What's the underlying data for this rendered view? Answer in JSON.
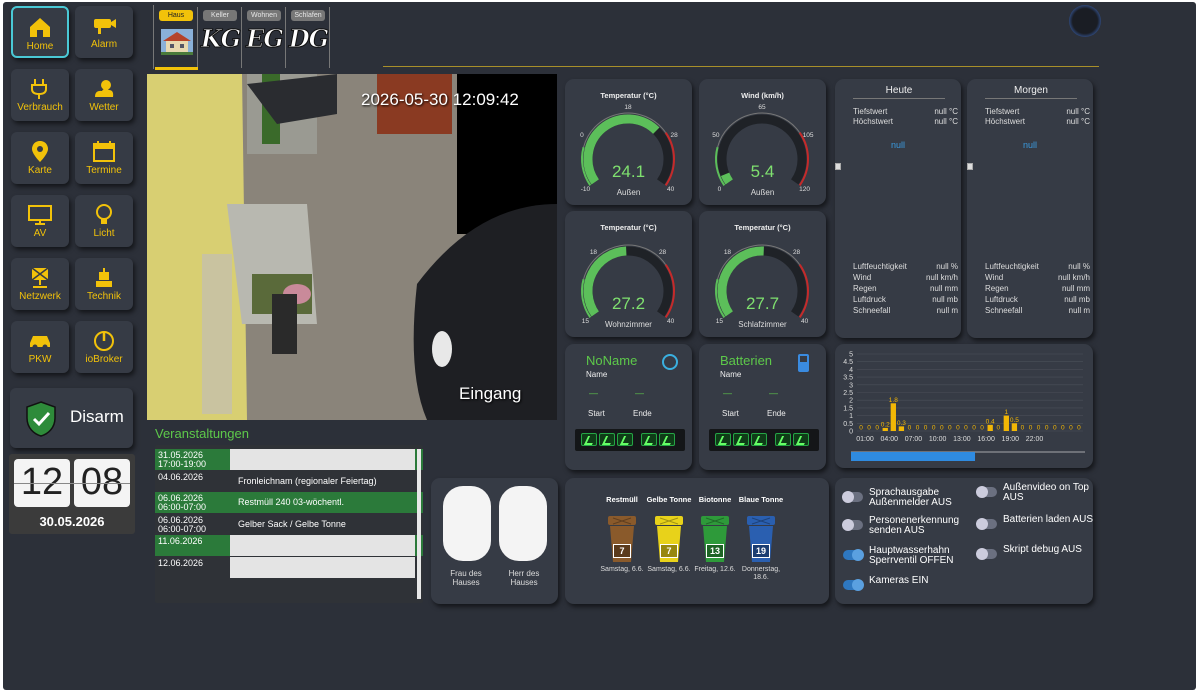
{
  "nav": [
    {
      "label": "Home",
      "icon": "home-icon"
    },
    {
      "label": "Alarm",
      "icon": "camera-icon"
    },
    {
      "label": "Verbrauch",
      "icon": "plug-icon"
    },
    {
      "label": "Wetter",
      "icon": "weather-icon"
    },
    {
      "label": "Karte",
      "icon": "map-pin-icon"
    },
    {
      "label": "Termine",
      "icon": "calendar-icon"
    },
    {
      "label": "AV",
      "icon": "tv-icon"
    },
    {
      "label": "Licht",
      "icon": "bulb-icon"
    },
    {
      "label": "Netzwerk",
      "icon": "network-icon"
    },
    {
      "label": "Technik",
      "icon": "robot-icon"
    },
    {
      "label": "PKW",
      "icon": "car-icon"
    },
    {
      "label": "ioBroker",
      "icon": "power-icon"
    }
  ],
  "disarm": {
    "label": "Disarm"
  },
  "clock": {
    "hours": "12",
    "minutes": "08",
    "date": "30.05.2026"
  },
  "tabs": [
    {
      "head": "Haus",
      "label": ""
    },
    {
      "head": "Keller",
      "label": "KG"
    },
    {
      "head": "Wohnen",
      "label": "EG"
    },
    {
      "head": "Schlafen",
      "label": "DG"
    }
  ],
  "camera": {
    "timestamp": "2026-05-30 12:09:42",
    "label": "Eingang"
  },
  "gauges": [
    {
      "title": "Temperatur (°C)",
      "value": "24.1",
      "sub": "Außen",
      "ticks": [
        "-10",
        "0",
        "18",
        "28",
        "40"
      ],
      "level": 0.68
    },
    {
      "title": "Wind (km/h)",
      "value": "5.4",
      "sub": "Außen",
      "ticks": [
        "0",
        "50",
        "65",
        "105",
        "120"
      ],
      "level": 0.05
    },
    {
      "title": "Temperatur (°C)",
      "value": "27.2",
      "sub": "Wohnzimmer",
      "ticks": [
        "15",
        "18",
        "28",
        "40"
      ],
      "level": 0.49
    },
    {
      "title": "Temperatur (°C)",
      "value": "27.7",
      "sub": "Schlafzimmer",
      "ticks": [
        "15",
        "18",
        "28",
        "40"
      ],
      "level": 0.51
    }
  ],
  "forecast": [
    {
      "day": "Heute",
      "tief_label": "Tiefstwert",
      "tief": "null °C",
      "hoch_label": "Höchstwert",
      "hoch": "null °C",
      "text": "null",
      "rows": [
        [
          "Luftfeuchtigkeit",
          "null %"
        ],
        [
          "Wind",
          "null km/h"
        ],
        [
          "Regen",
          "null mm"
        ],
        [
          "Luftdruck",
          "null mb"
        ],
        [
          "Schneefall",
          "null m"
        ]
      ]
    },
    {
      "day": "Morgen",
      "tief_label": "Tiefstwert",
      "tief": "null °C",
      "hoch_label": "Höchstwert",
      "hoch": "null °C",
      "text": "null",
      "rows": [
        [
          "Luftfeuchtigkeit",
          "null %"
        ],
        [
          "Wind",
          "null km/h"
        ],
        [
          "Regen",
          "null mm"
        ],
        [
          "Luftdruck",
          "null mb"
        ],
        [
          "Schneefall",
          "null m"
        ]
      ]
    }
  ],
  "media": [
    {
      "title": "NoName",
      "name_label": "Name",
      "start_label": "Start",
      "end_label": "Ende",
      "start": "—",
      "end": "—",
      "icon": "alexa-icon"
    },
    {
      "title": "Batterien",
      "name_label": "Name",
      "start_label": "Start",
      "end_label": "Ende",
      "start": "—",
      "end": "—",
      "icon": "battery-icon"
    }
  ],
  "events": {
    "title": "Veranstaltungen",
    "rows": [
      {
        "date": "31.05.2026 17:00-19:00",
        "text": "",
        "redacted": true
      },
      {
        "date": "04.06.2026",
        "text": "Fronleichnam (regionaler Feiertag)",
        "redacted": false
      },
      {
        "date": "06.06.2026 06:00-07:00",
        "text": "Restmüll 240 03-wöchentl.",
        "redacted": false
      },
      {
        "date": "06.06.2026 06:00-07:00",
        "text": "Gelber Sack / Gelbe Tonne",
        "redacted": false
      },
      {
        "date": "11.06.2026",
        "text": "",
        "redacted": true
      },
      {
        "date": "12.06.2026",
        "text": "",
        "redacted": true
      }
    ]
  },
  "persons": [
    {
      "label": "Frau des Hauses"
    },
    {
      "label": "Herr des Hauses"
    }
  ],
  "bins": [
    {
      "name": "Restmüll",
      "count": "7",
      "date": "Samstag, 6.6.",
      "color": "#8a5a2b"
    },
    {
      "name": "Gelbe Tonne",
      "count": "7",
      "date": "Samstag, 6.6.",
      "color": "#e8d21a"
    },
    {
      "name": "Biotonne",
      "count": "13",
      "date": "Freitag, 12.6.",
      "color": "#2e9a3a"
    },
    {
      "name": "Blaue Tonne",
      "count": "19",
      "date": "Donnerstag, 18.6.",
      "color": "#2a5fb0"
    }
  ],
  "toggles": [
    {
      "label": "Sprachausgabe Außenmelder AUS",
      "on": false
    },
    {
      "label": "Außenvideo on Top AUS",
      "on": false
    },
    {
      "label": "Personenerkennung senden AUS",
      "on": false
    },
    {
      "label": "Batterien laden AUS",
      "on": false
    },
    {
      "label": "Hauptwasserhahn Sperrventil OFFEN",
      "on": true
    },
    {
      "label": "Skript debug AUS",
      "on": false
    },
    {
      "label": "Kameras EIN",
      "on": true
    }
  ],
  "chart_data": {
    "type": "bar",
    "y_ticks": [
      "0",
      "0.5",
      "1",
      "1.5",
      "2",
      "2.5",
      "3",
      "3.5",
      "4",
      "4.5",
      "5"
    ],
    "x_ticks": [
      "01:00",
      "04:00",
      "07:00",
      "10:00",
      "13:00",
      "16:00",
      "19:00",
      "22:00"
    ],
    "ylim": [
      0,
      5
    ],
    "values": [
      0,
      0,
      0,
      0.2,
      1.8,
      0.3,
      0,
      0,
      0,
      0,
      0,
      0,
      0,
      0,
      0,
      0,
      0.4,
      0,
      1,
      0.5,
      0,
      0,
      0,
      0,
      0,
      0,
      0,
      0
    ],
    "labels": [
      "0",
      "0",
      "0",
      "0.2",
      "1.8",
      "0.3",
      "0",
      "0",
      "0",
      "0",
      "0",
      "0",
      "0",
      "0",
      "0",
      "0",
      "0.4",
      "0",
      "1",
      "0.5",
      "0",
      "0",
      "0",
      "0",
      "0",
      "0",
      "0",
      "0"
    ],
    "color": "#f2b705",
    "progress": 0.53
  }
}
